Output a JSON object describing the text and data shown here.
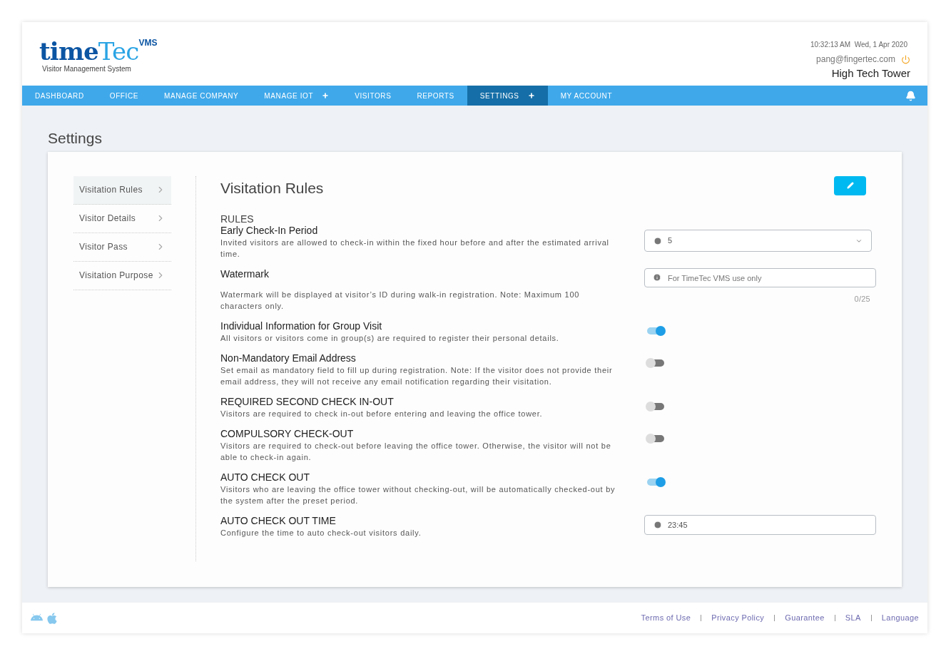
{
  "logo": {
    "part_1": "time",
    "part_2": "Tec",
    "badge": "VMS",
    "tagline": "Visitor Management System"
  },
  "header": {
    "datetime": "10:32:13 AM  Wed, 1 Apr 2020",
    "email": "pang@fingertec.com",
    "building": "High Tech Tower"
  },
  "nav": [
    {
      "label": "DASHBOARD",
      "selected": false,
      "expandable": false
    },
    {
      "label": "OFFICE",
      "selected": false,
      "expandable": false
    },
    {
      "label": "MANAGE COMPANY",
      "selected": false,
      "expandable": false
    },
    {
      "label": "MANAGE IOT",
      "selected": false,
      "expandable": true
    },
    {
      "label": "VISITORS",
      "selected": false,
      "expandable": false
    },
    {
      "label": "REPORTS",
      "selected": false,
      "expandable": false
    },
    {
      "label": "SETTINGS",
      "selected": true,
      "expandable": true
    },
    {
      "label": "MY ACCOUNT",
      "selected": false,
      "expandable": false
    }
  ],
  "page_title": "Settings",
  "side_menu": [
    {
      "label": "Visitation Rules",
      "selected": true
    },
    {
      "label": "Visitor Details",
      "selected": false
    },
    {
      "label": "Visitor Pass",
      "selected": false
    },
    {
      "label": "Visitation Purpose",
      "selected": false
    }
  ],
  "panel": {
    "title": "Visitation Rules",
    "section": "RULES",
    "rules": [
      {
        "kind": "select",
        "title": "Early Check-In Period",
        "description": "Invited visitors are allowed to check-in within the fixed hour before and after the estimated arrival time.",
        "value": "5"
      },
      {
        "kind": "text",
        "title": "Watermark",
        "description": "Watermark will be displayed at visitor’s ID during walk-in registration. Note: Maximum 100 characters only.",
        "placeholder": "For TimeTec VMS use only",
        "counter": "0/25"
      },
      {
        "kind": "toggle",
        "title": "Individual Information for Group Visit",
        "description": "All visitors or visitors come in group(s) are required to register their personal details.",
        "on": true
      },
      {
        "kind": "toggle",
        "title": "Non-Mandatory Email Address",
        "description": "Set email as mandatory field to fill up during registration. Note: If the visitor does not provide their email address, they will not receive any email notification regarding their visitation.",
        "on": false
      },
      {
        "kind": "toggle",
        "title": "REQUIRED SECOND CHECK IN-OUT",
        "description": "Visitors are required to check in-out before entering and leaving the office tower.",
        "on": false
      },
      {
        "kind": "toggle",
        "title": "COMPULSORY CHECK-OUT",
        "description": "Visitors are required to check-out before leaving the office tower. Otherwise, the visitor will not be able to check-in again.",
        "on": false
      },
      {
        "kind": "toggle",
        "title": "AUTO CHECK OUT",
        "description": "Visitors who are leaving the office tower without checking-out, will be automatically checked-out by the system after the preset period.",
        "on": true
      },
      {
        "kind": "time",
        "title": "AUTO CHECK OUT TIME",
        "description": "Configure the time to auto check-out visitors daily.",
        "value": "23:45"
      }
    ]
  },
  "footer_links": [
    "Terms of Use",
    "Privacy Policy",
    "Guarantee",
    "SLA",
    "Language"
  ]
}
